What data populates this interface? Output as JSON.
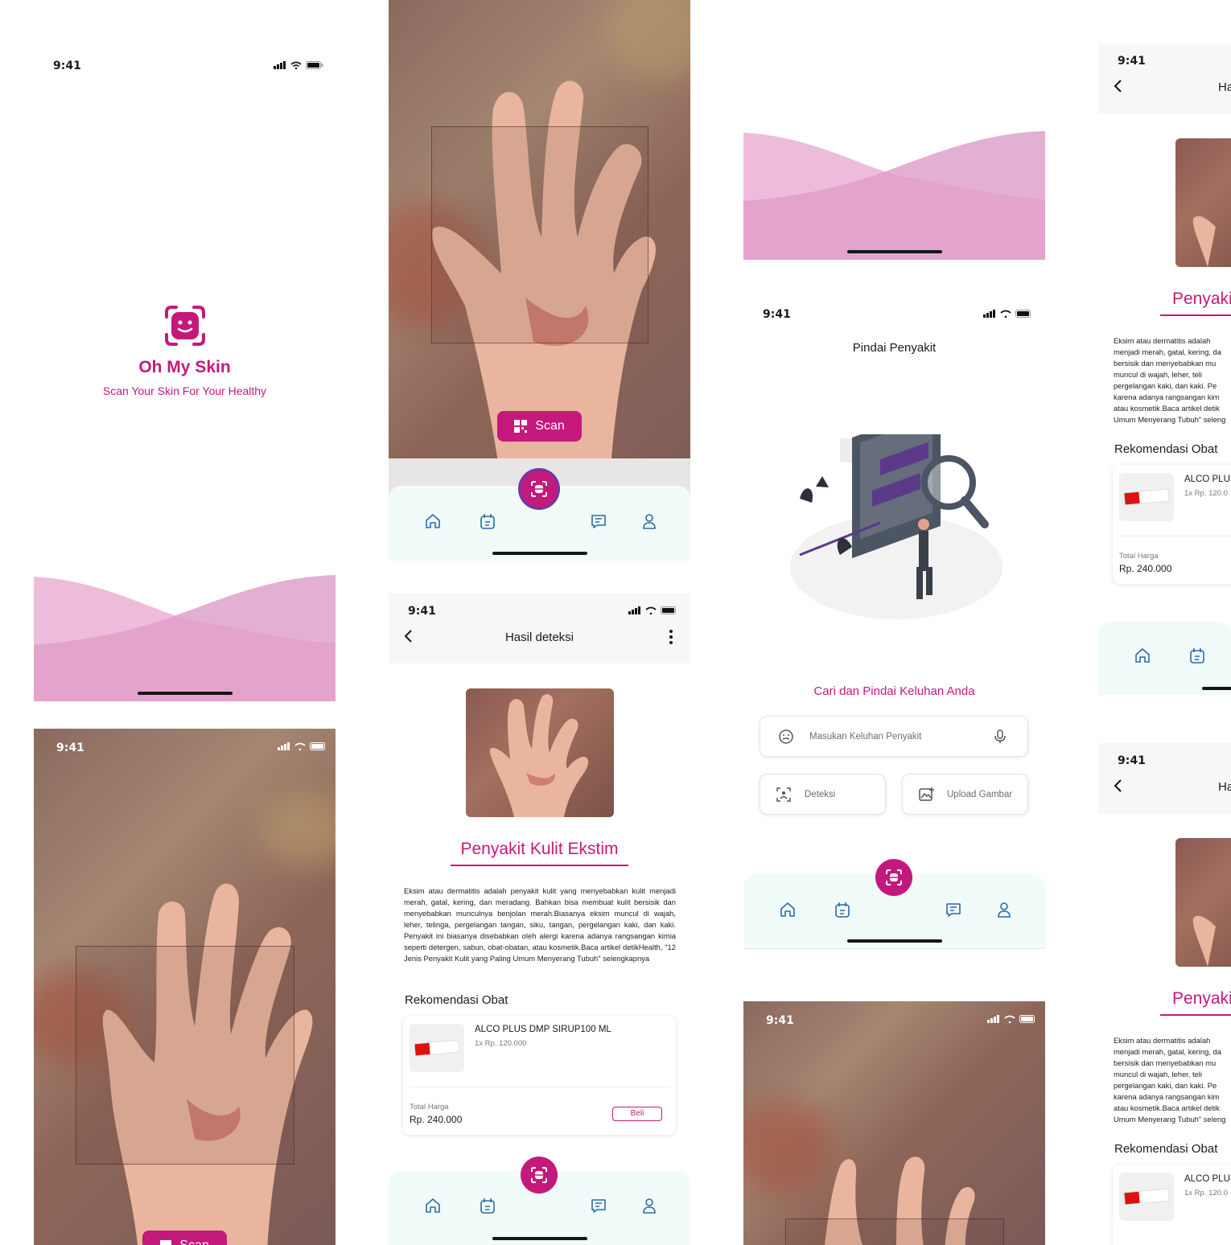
{
  "status": {
    "time": "9:41"
  },
  "splash": {
    "app_name": "Oh My Skin",
    "tagline": "Scan Your Skin For Your Healthy"
  },
  "camera": {
    "scan_label": "Scan"
  },
  "result": {
    "title": "Hasil deteksi",
    "title_cropped": "Ha",
    "disease": "Penyakit Kulit Ekstim",
    "disease_cropped": "Penyakit",
    "description": "Eksim atau dermatitis adalah penyakit kulit yang menyebabkan kulit menjadi merah, gatal, kering, dan meradang. Bahkan bisa membuat kulit bersisik dan menyebabkan munculnya benjolan merah.Biasanya eksim muncul di wajah, leher, telinga, pergelangan tangan, siku, tangan, pergelangan kaki, dan kaki. Penyakit ini biasanya disebabkan oleh alergi karena adanya rangsangan kimia seperti detergen, sabun, obat-obatan, atau kosmetik.Baca artikel detikHealth, \"12 Jenis Penyakit Kulit yang Paling Umum Menyerang Tubuh\" selengkapnya",
    "description_cropped": "Eksim atau dermatitis adalah menjadi merah, gatal, kering, da bersisik dan menyebabkan mu muncul di wajah, leher, teli pergelangan kaki, dan kaki. Pe karena adanya rangsangan kim atau kosmetik.Baca artikel detik Umum Menyerang Tubuh\" seleng",
    "recommend_title": "Rekomendasi Obat",
    "product_name": "ALCO PLUS DMP SIRUP100 ML",
    "product_name_cropped": "ALCO PLUS",
    "product_price": "1x Rp. 120.000",
    "product_price_cropped": "1x Rp. 120.0",
    "total_label": "Total Harga",
    "total_value": "Rp. 240.000",
    "buy_label": "Beli"
  },
  "search": {
    "title": "Pindai Penyakit",
    "heading": "Cari dan Pindai Keluhan Anda",
    "input_placeholder": "Masukan Keluhan Penyakit",
    "detect_label": "Deteksi",
    "upload_label": "Upload Gambar"
  },
  "colors": {
    "primary": "#c4197c",
    "nav_bg": "#f1fbf9"
  },
  "icons": [
    "home-icon",
    "calendar-icon",
    "scan-icon",
    "chat-icon",
    "profile-icon",
    "back-icon",
    "more-icon",
    "mic-icon",
    "emoji-icon",
    "detect-icon",
    "upload-icon"
  ]
}
